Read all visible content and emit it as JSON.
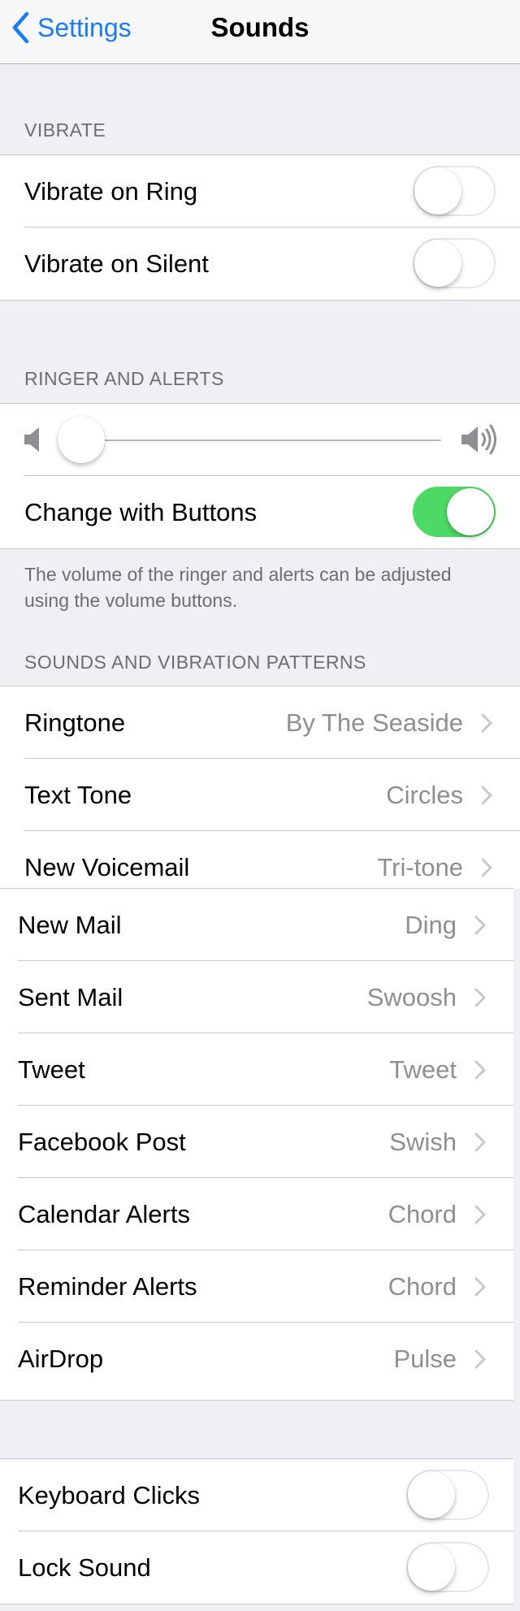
{
  "nav": {
    "back_label": "Settings",
    "title": "Sounds"
  },
  "vibrate": {
    "header": "VIBRATE",
    "items": [
      {
        "label": "Vibrate on Ring",
        "on": false
      },
      {
        "label": "Vibrate on Silent",
        "on": false
      }
    ]
  },
  "ringer": {
    "header": "RINGER AND ALERTS",
    "volume_level": 0.0,
    "change_with_buttons": {
      "label": "Change with Buttons",
      "on": true
    },
    "footer": "The volume of the ringer and alerts can be adjusted using the volume buttons."
  },
  "patterns": {
    "header": "SOUNDS AND VIBRATION PATTERNS",
    "items_top": [
      {
        "label": "Ringtone",
        "value": "By The Seaside"
      },
      {
        "label": "Text Tone",
        "value": "Circles"
      },
      {
        "label": "New Voicemail",
        "value": "Tri-tone"
      }
    ],
    "items_bottom": [
      {
        "label": "New Mail",
        "value": "Ding"
      },
      {
        "label": "Sent Mail",
        "value": "Swoosh"
      },
      {
        "label": "Tweet",
        "value": "Tweet"
      },
      {
        "label": "Facebook Post",
        "value": "Swish"
      },
      {
        "label": "Calendar Alerts",
        "value": "Chord"
      },
      {
        "label": "Reminder Alerts",
        "value": "Chord"
      },
      {
        "label": "AirDrop",
        "value": "Pulse"
      }
    ]
  },
  "other": {
    "items": [
      {
        "label": "Keyboard Clicks",
        "on": false
      },
      {
        "label": "Lock Sound",
        "on": false
      }
    ]
  },
  "colors": {
    "accent": "#1a7cf5",
    "toggle_on": "#4cd964",
    "secondary_text": "#8e8e93",
    "background": "#efeff4"
  }
}
